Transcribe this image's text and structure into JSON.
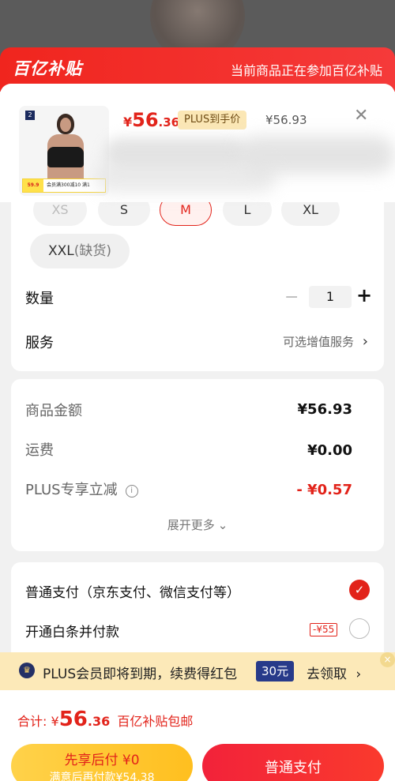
{
  "banner": {
    "brand": "百亿补贴",
    "note": "当前商品正在参加百亿补贴"
  },
  "product": {
    "price_currency": "¥",
    "price_int": "56",
    "price_dec": ".36",
    "plus_label": "PLUS到手价",
    "original_price": "¥56.93",
    "thumb_badge": "2",
    "thumb_tag_price": "59.9",
    "thumb_tag_text": "会员满300减10 满1"
  },
  "sizes": {
    "options": [
      {
        "label": "XS",
        "state": "disabled"
      },
      {
        "label": "S",
        "state": "normal"
      },
      {
        "label": "M",
        "state": "selected"
      },
      {
        "label": "L",
        "state": "normal"
      },
      {
        "label": "XL",
        "state": "normal"
      }
    ],
    "xxl_label": "XXL",
    "xxl_oos": "(缺货)"
  },
  "quantity": {
    "label": "数量",
    "minus": "−",
    "value": "1",
    "plus": "+"
  },
  "service": {
    "label": "服务",
    "value": "可选增值服务",
    "chevron": "›"
  },
  "fees": {
    "goods_label": "商品金额",
    "goods_value": "¥56.93",
    "shipping_label": "运费",
    "shipping_value": "¥0.00",
    "plus_discount_label": "PLUS专享立减",
    "plus_discount_value": "- ¥0.57",
    "expand_label": "展开更多",
    "expand_chevron": "⌄"
  },
  "payment": {
    "normal_label": "普通支付（京东支付、微信支付等）",
    "baitiao_label": "开通白条并付款",
    "baitiao_tag": "-¥55",
    "check_mark": "✓"
  },
  "plus_bar": {
    "text": "PLUS会员即将到期，续费得红包",
    "chip": "30元",
    "link": "去领取",
    "chevron": "›",
    "close": "×"
  },
  "bottom": {
    "total_label": "合计:",
    "total_currency": "¥",
    "total_int": "56",
    "total_dec": ".36",
    "total_note": "百亿补贴包邮",
    "later_line1": "先享后付 ¥0",
    "later_line2": "满意后再付款¥54.38",
    "pay_label": "普通支付"
  },
  "colors": {
    "accent": "#e2231a",
    "plus_gold": "#fbe7b5",
    "pay_yellow": "#ffc72c"
  }
}
